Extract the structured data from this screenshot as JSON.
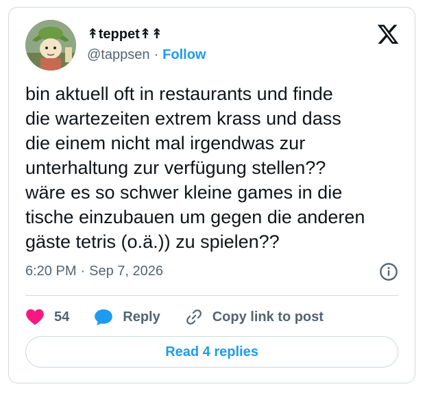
{
  "author": {
    "display_name": "↟teppet↟↟",
    "handle": "@tappsen",
    "separator": "·",
    "follow_label": "Follow",
    "avatar_icon": "cartoon-character-avatar"
  },
  "brand": {
    "logo_icon": "x-logo"
  },
  "tweet": {
    "text": "bin aktuell oft in restaurants und finde\ndie wartezeiten extrem krass und dass\ndie einem nicht mal irgendwas zur\nunterhaltung zur verfügung stellen??\nwäre es so schwer kleine games in die\ntische einzubauen um gegen die anderen\ngäste tetris (o.ä.)) zu spielen??",
    "time": "6:20 PM",
    "separator": "·",
    "date": "Sep 7, 2026"
  },
  "actions": {
    "like_count": "54",
    "reply_label": "Reply",
    "copy_link_label": "Copy link to post"
  },
  "read_replies_label": "Read 4 replies",
  "colors": {
    "like": "#f91880",
    "reply": "#1d9bf0",
    "link": "#1d9bf0",
    "muted": "#536471",
    "border": "#cfd9de"
  }
}
